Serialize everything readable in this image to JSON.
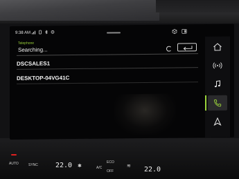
{
  "statusbar": {
    "time": "9:38 AM"
  },
  "app": {
    "title": "Telephone",
    "status": "Searching..."
  },
  "devices": [
    {
      "name": "DSCSALES1"
    },
    {
      "name": "DESKTOP-04VG41C"
    }
  ],
  "sidenav": [
    {
      "icon": "home-icon"
    },
    {
      "icon": "radio-icon"
    },
    {
      "icon": "music-note-icon"
    },
    {
      "icon": "phone-icon",
      "active": true
    },
    {
      "icon": "navigation-arrow-icon"
    }
  ],
  "climate": {
    "auto_label": "AUTO",
    "sync_label": "SYNC",
    "left_temp": "22.0",
    "right_temp": "22.0",
    "ac_label": "A/C",
    "eco_label": "ECO",
    "off_label": "OFF"
  },
  "colors": {
    "accent": "#9bd33a",
    "led": "#e02020"
  }
}
